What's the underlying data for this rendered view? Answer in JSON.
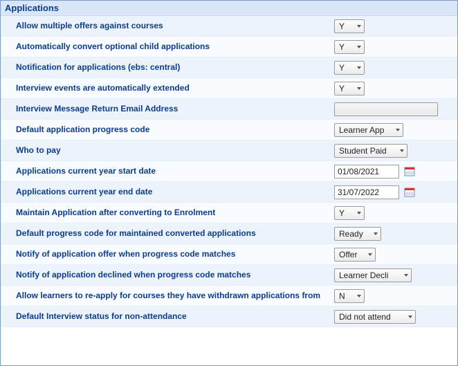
{
  "panel": {
    "title": "Applications"
  },
  "rows": {
    "allow_multiple_offers": {
      "label": "Allow multiple offers against courses",
      "value": "Y"
    },
    "auto_convert_optional": {
      "label": "Automatically convert optional child applications",
      "value": "Y"
    },
    "notification_ebs": {
      "label": "Notification for applications (ebs: central)",
      "value": "Y"
    },
    "interview_auto_extend": {
      "label": "Interview events are automatically extended",
      "value": "Y"
    },
    "interview_return_email": {
      "label": "Interview Message Return Email Address",
      "value": ""
    },
    "default_progress_code": {
      "label": "Default application progress code",
      "value": "Learner App"
    },
    "who_to_pay": {
      "label": "Who to pay",
      "value": "Student Paid"
    },
    "year_start": {
      "label": "Applications current year start date",
      "value": "01/08/2021"
    },
    "year_end": {
      "label": "Applications current year end date",
      "value": "31/07/2022"
    },
    "maintain_after_enrol": {
      "label": "Maintain Application after converting to Enrolment",
      "value": "Y"
    },
    "default_maintained_code": {
      "label": "Default progress code for maintained converted applications",
      "value": "Ready"
    },
    "notify_offer_match": {
      "label": "Notify of application offer when progress code matches",
      "value": "Offer"
    },
    "notify_declined_match": {
      "label": "Notify of application declined when progress code matches",
      "value": "Learner Decli"
    },
    "allow_reapply_withdrawn": {
      "label": "Allow learners to re-apply for courses they have withdrawn applications from",
      "value": "N"
    },
    "default_interview_nonattend": {
      "label": "Default Interview status for non-attendance",
      "value": "Did not attend"
    }
  }
}
